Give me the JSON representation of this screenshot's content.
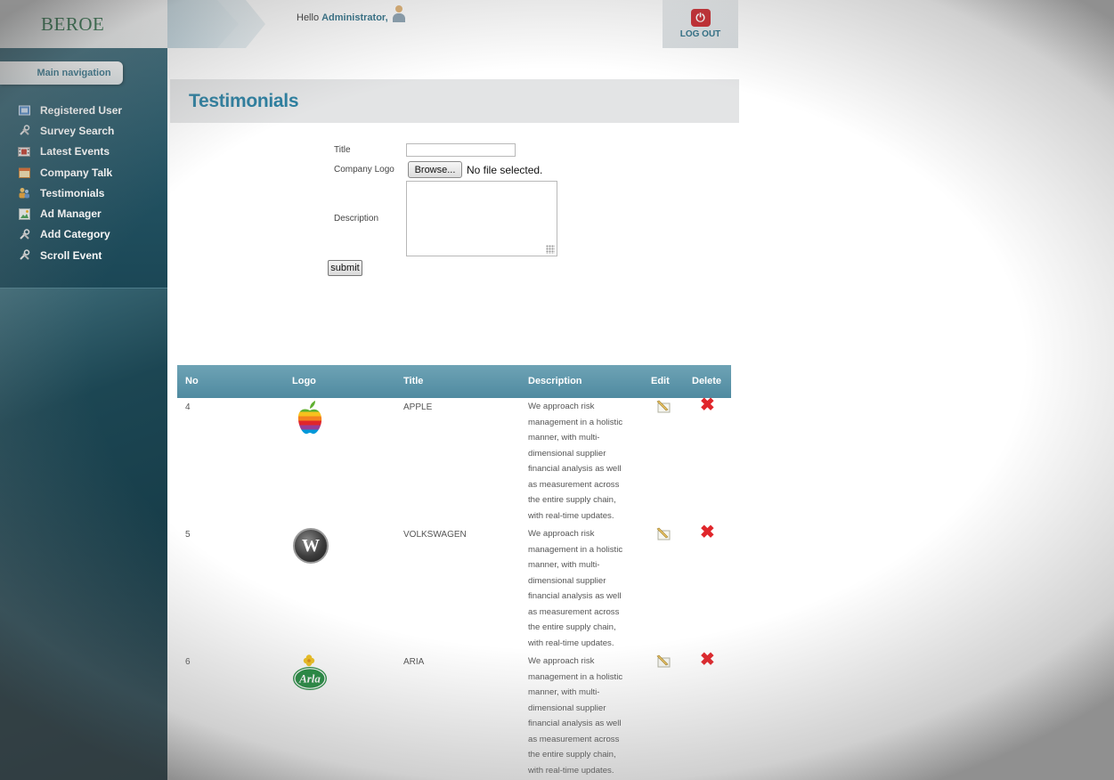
{
  "brand": {
    "name": "BEROE"
  },
  "header": {
    "hello_prefix": "Hello",
    "user_name": "Administrator,",
    "logout_label": "LOG OUT"
  },
  "sidebar": {
    "title": "Main navigation",
    "items": [
      {
        "label": "Registered User",
        "icon": "user-card-icon"
      },
      {
        "label": "Survey Search",
        "icon": "tools-icon"
      },
      {
        "label": "Latest Events",
        "icon": "film-icon"
      },
      {
        "label": "Company Talk",
        "icon": "calendar-icon"
      },
      {
        "label": "Testimonials",
        "icon": "people-icon"
      },
      {
        "label": "Ad Manager",
        "icon": "image-icon"
      },
      {
        "label": "Add Category",
        "icon": "tools-icon"
      },
      {
        "label": "Scroll Event",
        "icon": "tools-icon"
      }
    ]
  },
  "page": {
    "title": "Testimonials"
  },
  "form": {
    "title_label": "Title",
    "title_value": "",
    "logo_label": "Company Logo",
    "browse_label": "Browse...",
    "no_file": "No file selected.",
    "description_label": "Description",
    "description_value": "",
    "submit_label": "submit"
  },
  "table": {
    "columns": [
      "No",
      "Logo",
      "Title",
      "Description",
      "Edit",
      "Delete"
    ],
    "rows": [
      {
        "no": "4",
        "logo": "apple-logo",
        "title": "APPLE",
        "description": [
          "We approach risk",
          "management in a holistic",
          "manner, with multi-",
          "dimensional supplier",
          "financial analysis as well",
          "as measurement across",
          "the entire supply chain,",
          "with real-time updates."
        ]
      },
      {
        "no": "5",
        "logo": "wordpress-logo",
        "title": "VOLKSWAGEN",
        "description": [
          "We approach risk",
          "management in a holistic",
          "manner, with multi-",
          "dimensional supplier",
          "financial analysis as well",
          "as measurement across",
          "the entire supply chain,",
          "with real-time updates."
        ]
      },
      {
        "no": "6",
        "logo": "arla-logo",
        "title": "ARIA",
        "description": [
          "We approach risk",
          "management in a holistic",
          "manner, with multi-",
          "dimensional supplier",
          "financial analysis as well",
          "as measurement across",
          "the entire supply chain,",
          "with real-time updates."
        ]
      }
    ]
  },
  "colors": {
    "accent": "#2b7fa0",
    "sidebar_bg": "#1b4756",
    "table_header": "#5b94a9",
    "delete_red": "#e0262b"
  }
}
